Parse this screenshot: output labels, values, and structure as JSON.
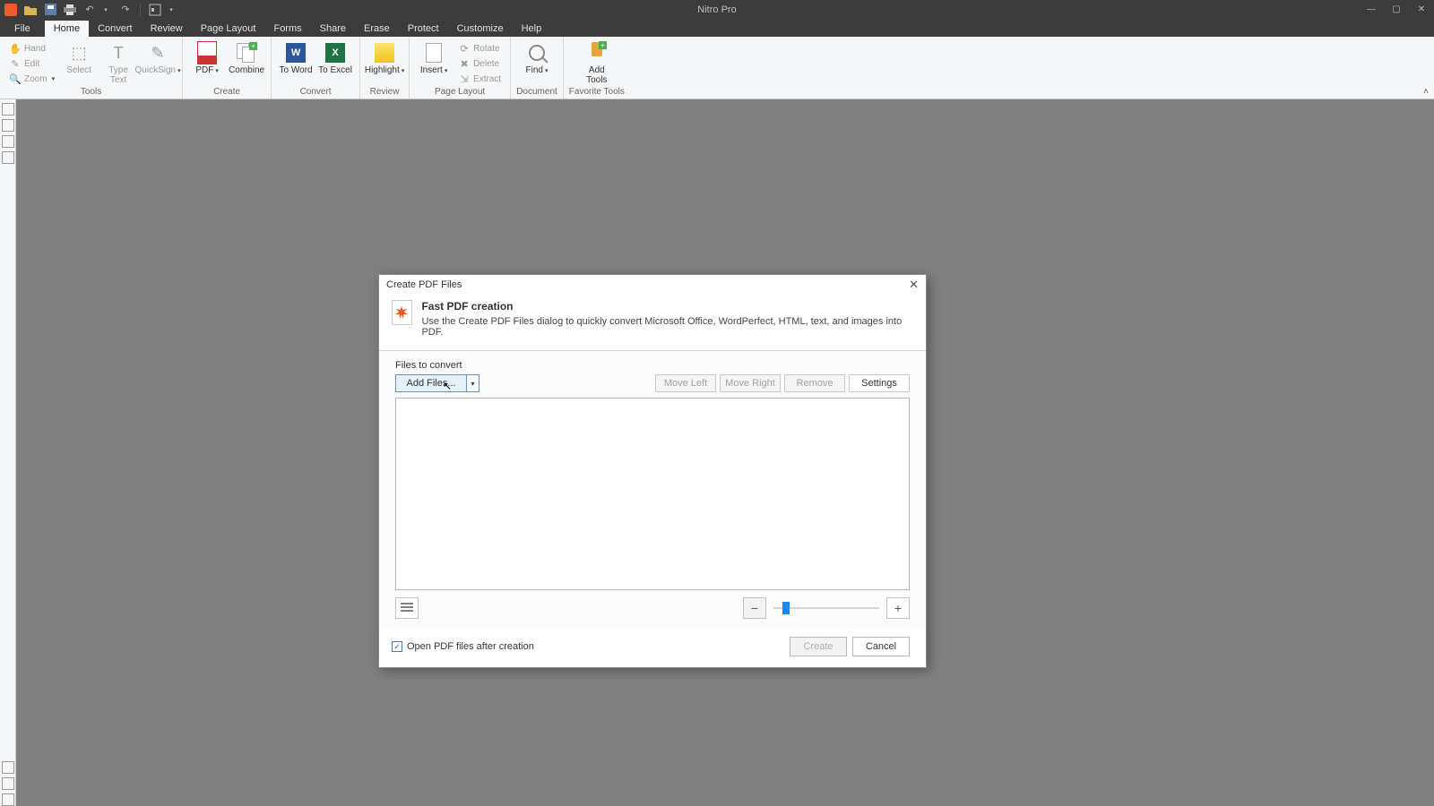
{
  "app": {
    "title": "Nitro Pro"
  },
  "qat": {
    "items": [
      "brand",
      "open",
      "save",
      "print",
      "undo",
      "undo-dd",
      "redo",
      "redo-dd",
      "sep",
      "customize",
      "customize-dd"
    ]
  },
  "win": {
    "min": "—",
    "max": "▢",
    "close": "✕"
  },
  "menu": {
    "tabs": [
      "File",
      "Home",
      "Convert",
      "Review",
      "Page Layout",
      "Forms",
      "Share",
      "Erase",
      "Protect",
      "Customize",
      "Help"
    ],
    "activeIndex": 1
  },
  "ribbon": {
    "groups": [
      {
        "name": "Tools",
        "smallItems": [
          "Hand",
          "Edit",
          "Zoom"
        ],
        "bigItems": [
          {
            "label": "Select",
            "hasDropdown": false,
            "disabled": true
          },
          {
            "label": "Type Text",
            "hasDropdown": false,
            "disabled": true
          },
          {
            "label": "QuickSign",
            "hasDropdown": true,
            "disabled": true
          }
        ]
      },
      {
        "name": "Create",
        "bigItems": [
          {
            "label": "PDF",
            "hasDropdown": true
          },
          {
            "label": "Combine",
            "hasDropdown": false
          }
        ]
      },
      {
        "name": "Convert",
        "bigItems": [
          {
            "label": "To Word",
            "hasDropdown": false
          },
          {
            "label": "To Excel",
            "hasDropdown": false
          }
        ]
      },
      {
        "name": "Review",
        "bigItems": [
          {
            "label": "Highlight",
            "hasDropdown": true
          }
        ]
      },
      {
        "name": "Page Layout",
        "bigItems": [
          {
            "label": "Insert",
            "hasDropdown": true
          }
        ],
        "smallItems2": [
          "Rotate",
          "Delete",
          "Extract"
        ]
      },
      {
        "name": "Document",
        "bigItems": [
          {
            "label": "Find",
            "hasDropdown": true
          }
        ]
      },
      {
        "name": "Favorite Tools",
        "bigItems": [
          {
            "label": "Add Tools",
            "hasDropdown": false
          }
        ]
      }
    ]
  },
  "dialog": {
    "title": "Create PDF Files",
    "heading": "Fast PDF creation",
    "description": "Use the Create PDF Files dialog to quickly convert Microsoft Office, WordPerfect, HTML, text, and images into PDF.",
    "section_label": "Files to convert",
    "add_files": "Add Files...",
    "move_left": "Move Left",
    "move_right": "Move Right",
    "remove": "Remove",
    "settings": "Settings",
    "open_after": "Open PDF files after creation",
    "create": "Create",
    "cancel": "Cancel"
  }
}
